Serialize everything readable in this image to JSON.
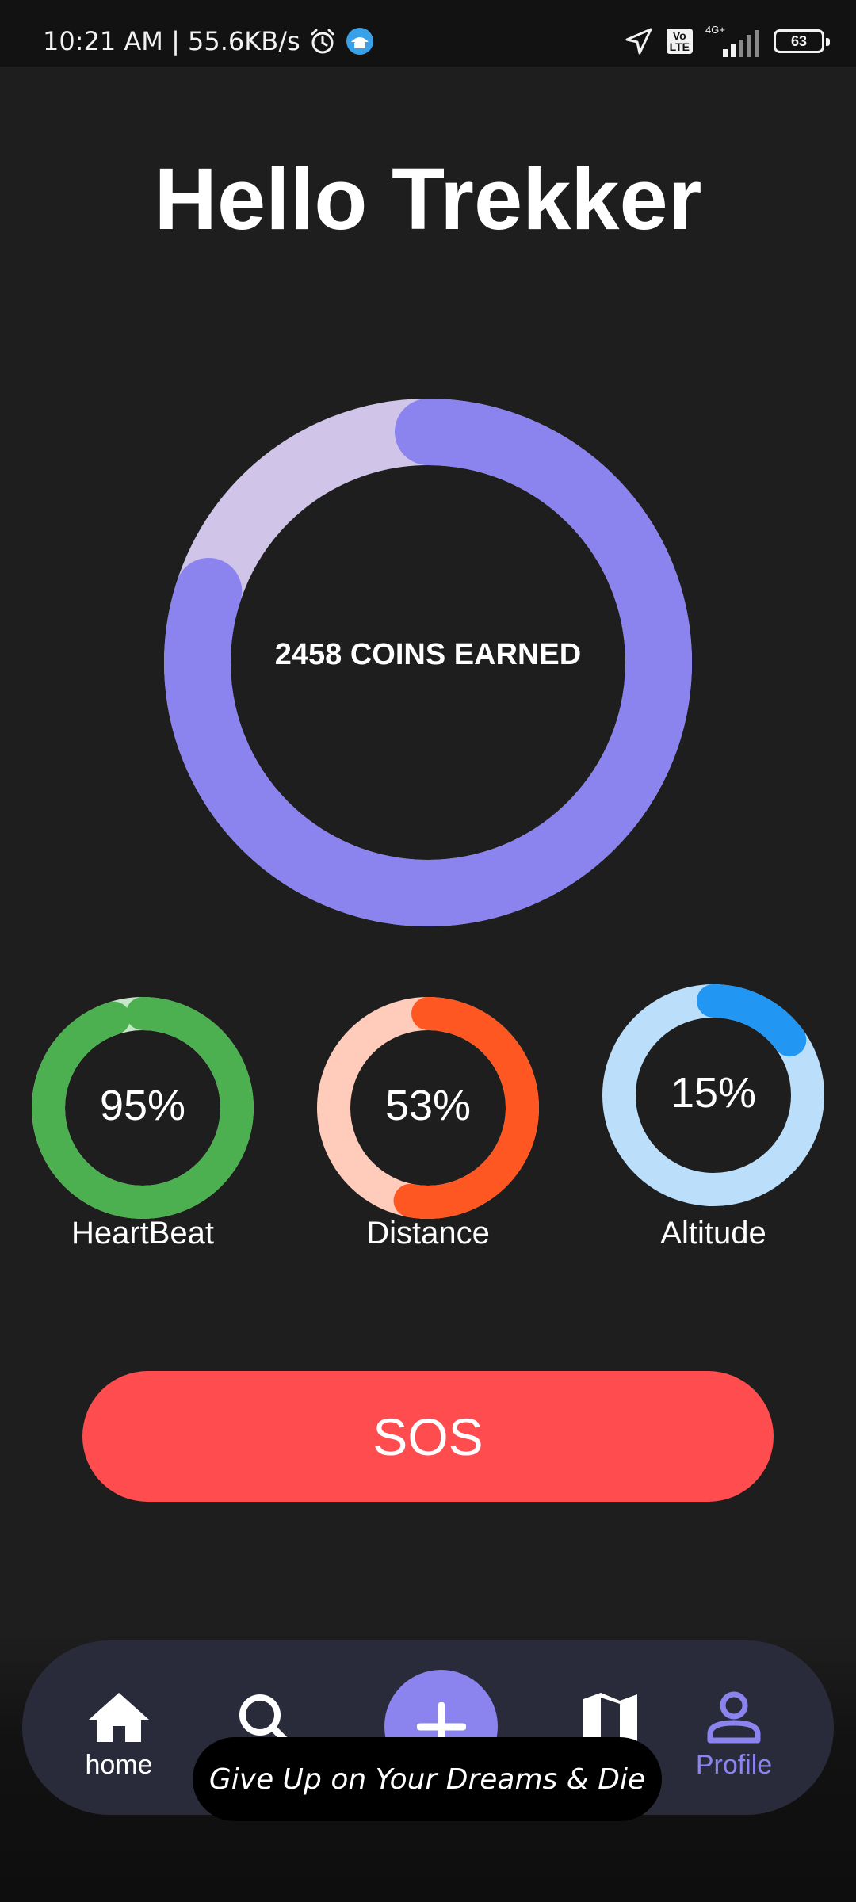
{
  "status_bar": {
    "time_speed": "10:21 AM | 55.6KB/s",
    "network": "4G+",
    "volte": "Vo\nLTE",
    "battery": "63",
    "icons": [
      "alarm-icon",
      "app-notification-icon",
      "location-arrow-icon",
      "volte-icon",
      "signal-icon",
      "battery-icon"
    ]
  },
  "header": {
    "title": "Hello Trekker"
  },
  "coins": {
    "label": "2458 COINS EARNED",
    "progress_fraction": 0.8,
    "colors": {
      "track": "#d1c4e9",
      "fill": "#8b84ef"
    }
  },
  "metrics": [
    {
      "label": "HeartBeat",
      "value": "95%",
      "progress_fraction": 0.95,
      "track": "#c8e6c9",
      "fill": "#4caf50"
    },
    {
      "label": "Distance",
      "value": "53%",
      "progress_fraction": 0.53,
      "track": "#ffccbc",
      "fill": "#ff5722"
    },
    {
      "label": "Altitude",
      "value": "15%",
      "progress_fraction": 0.15,
      "track": "#bbdefb",
      "fill": "#2196f3"
    }
  ],
  "sos": {
    "label": "SOS",
    "color": "#ff4d4f"
  },
  "nav": {
    "items": [
      {
        "label": "home",
        "icon": "home-icon"
      },
      {
        "label": "",
        "icon": "search-icon"
      },
      {
        "label": "",
        "icon": "plus-icon"
      },
      {
        "label": "",
        "icon": "map-icon"
      },
      {
        "label": "Profile",
        "icon": "profile-icon"
      }
    ],
    "active_color": "#8b84ef"
  },
  "toast": {
    "message": "Give Up on Your Dreams & Die"
  }
}
